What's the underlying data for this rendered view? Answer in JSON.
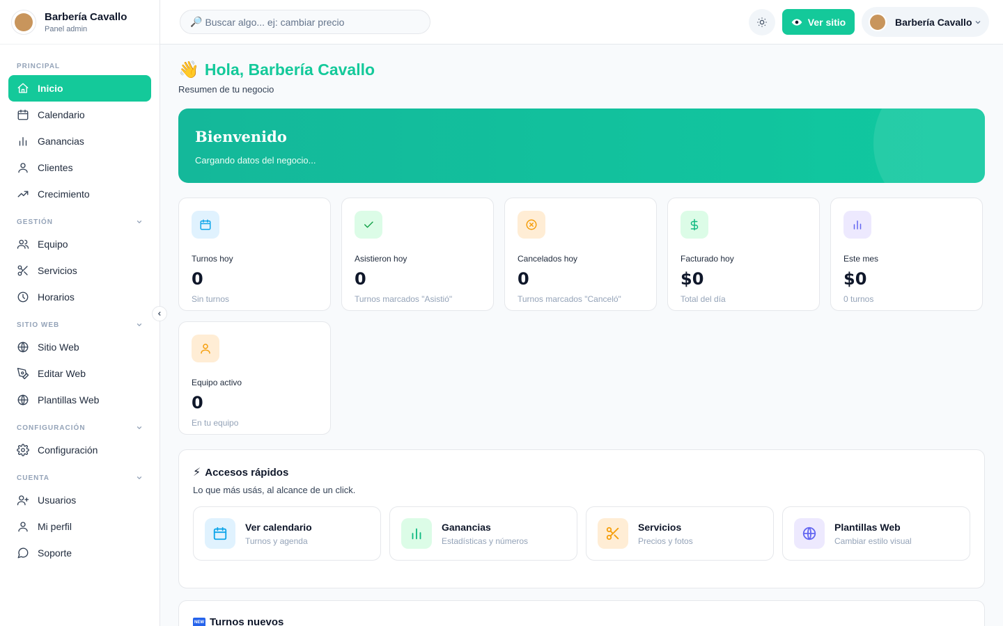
{
  "brand": {
    "name": "Barbería Cavallo",
    "subtitle": "Panel admin"
  },
  "sidebar": {
    "sections": [
      {
        "title": "PRINCIPAL",
        "collapsible": false,
        "items": [
          {
            "label": "Inicio",
            "icon": "home-icon",
            "active": true
          },
          {
            "label": "Calendario",
            "icon": "calendar-icon"
          },
          {
            "label": "Ganancias",
            "icon": "bar-chart-icon"
          },
          {
            "label": "Clientes",
            "icon": "user-icon"
          },
          {
            "label": "Crecimiento",
            "icon": "trending-up-icon"
          }
        ]
      },
      {
        "title": "GESTIÓN",
        "collapsible": true,
        "items": [
          {
            "label": "Equipo",
            "icon": "users-icon"
          },
          {
            "label": "Servicios",
            "icon": "scissors-icon"
          },
          {
            "label": "Horarios",
            "icon": "clock-icon"
          }
        ]
      },
      {
        "title": "SITIO WEB",
        "collapsible": true,
        "items": [
          {
            "label": "Sitio Web",
            "icon": "globe-icon"
          },
          {
            "label": "Editar Web",
            "icon": "pen-tool-icon"
          },
          {
            "label": "Plantillas Web",
            "icon": "globe-icon"
          }
        ]
      },
      {
        "title": "CONFIGURACIÓN",
        "collapsible": true,
        "items": [
          {
            "label": "Configuración",
            "icon": "gear-icon"
          }
        ]
      },
      {
        "title": "CUENTA",
        "collapsible": true,
        "items": [
          {
            "label": "Usuarios",
            "icon": "user-plus-icon"
          },
          {
            "label": "Mi perfil",
            "icon": "user-icon"
          },
          {
            "label": "Soporte",
            "icon": "message-circle-icon"
          }
        ]
      }
    ]
  },
  "header": {
    "search_icon": "🔎",
    "search_placeholder": "Buscar algo... ej: cambiar precio",
    "view_site_label": "Ver sitio",
    "user_name": "Barbería Cavallo",
    "accent": "#14c99a"
  },
  "main": {
    "greeting_emoji": "👋",
    "greeting": "Hola, Barbería Cavallo",
    "greeting_sub": "Resumen de tu negocio",
    "banner": {
      "title": "Bienvenido",
      "text": "Cargando datos del negocio..."
    },
    "stats": [
      {
        "label": "Turnos hoy",
        "value": "0",
        "sub": "Sin turnos",
        "icon": "calendar-icon",
        "bg": "#e0f2fe",
        "color": "#0ea5e9"
      },
      {
        "label": "Asistieron hoy",
        "value": "0",
        "sub": "Turnos marcados \"Asistió\"",
        "icon": "check-icon",
        "bg": "#dcfce7",
        "color": "#16a34a"
      },
      {
        "label": "Cancelados hoy",
        "value": "0",
        "sub": "Turnos marcados \"Canceló\"",
        "icon": "x-circle-icon",
        "bg": "#ffedd5",
        "color": "#f59e0b"
      },
      {
        "label": "Facturado hoy",
        "value": "$0",
        "sub": "Total del día",
        "icon": "dollar-icon",
        "bg": "#dcfce7",
        "color": "#10b981"
      },
      {
        "label": "Este mes",
        "value": "$0",
        "sub": "0 turnos",
        "icon": "bar-chart-icon",
        "bg": "#ede9fe",
        "color": "#6366f1"
      },
      {
        "label": "Equipo activo",
        "value": "0",
        "sub": "En tu equipo",
        "icon": "user-icon",
        "bg": "#ffedd5",
        "color": "#f59e0b"
      }
    ],
    "quick": {
      "icon": "⚡",
      "title": "Accesos rápidos",
      "subtitle": "Lo que más usás, al alcance de un click.",
      "items": [
        {
          "title": "Ver calendario",
          "sub": "Turnos y agenda",
          "icon": "calendar-icon",
          "bg": "#e0f2fe",
          "color": "#0ea5e9"
        },
        {
          "title": "Ganancias",
          "sub": "Estadísticas y números",
          "icon": "bar-chart-icon",
          "bg": "#dcfce7",
          "color": "#10b981"
        },
        {
          "title": "Servicios",
          "sub": "Precios y fotos",
          "icon": "scissors-icon",
          "bg": "#ffedd5",
          "color": "#f59e0b"
        },
        {
          "title": "Plantillas Web",
          "sub": "Cambiar estilo visual",
          "icon": "globe-icon",
          "bg": "#ede9fe",
          "color": "#6366f1"
        }
      ]
    },
    "new_turns": {
      "badge": "NEW",
      "title": "Turnos nuevos"
    }
  }
}
